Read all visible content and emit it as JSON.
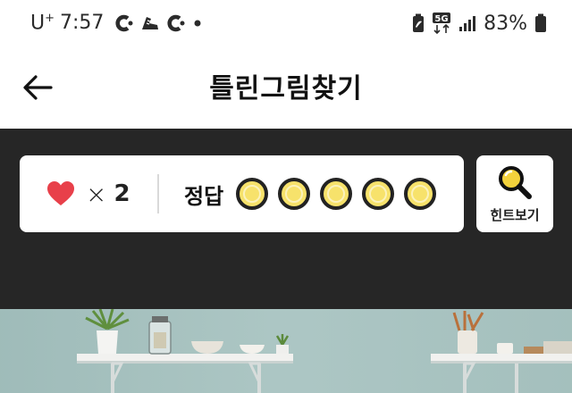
{
  "status_bar": {
    "carrier": "U",
    "carrier_sup": "+",
    "time": "7:57",
    "network": "5G",
    "battery": "83%",
    "icons": [
      "c-notification-icon",
      "sneaker-icon",
      "c-notification-icon",
      "dot-icon",
      "battery-saver-icon",
      "5g-icon",
      "signal-icon",
      "battery-icon"
    ]
  },
  "header": {
    "title": "틀린그림찾기",
    "back_icon": "arrow-left-icon"
  },
  "game": {
    "lives_count": "2",
    "lives_x": "×",
    "answers_label": "정답",
    "answer_slots": 5,
    "answers_found": 0,
    "hint_label": "힌트보기",
    "hint_icon": "magnifier-icon"
  },
  "colors": {
    "game_bg": "#262626",
    "heart": "#e8404a",
    "slot_fill": "#f7e26b",
    "hint_lens": "#f3d23c"
  }
}
